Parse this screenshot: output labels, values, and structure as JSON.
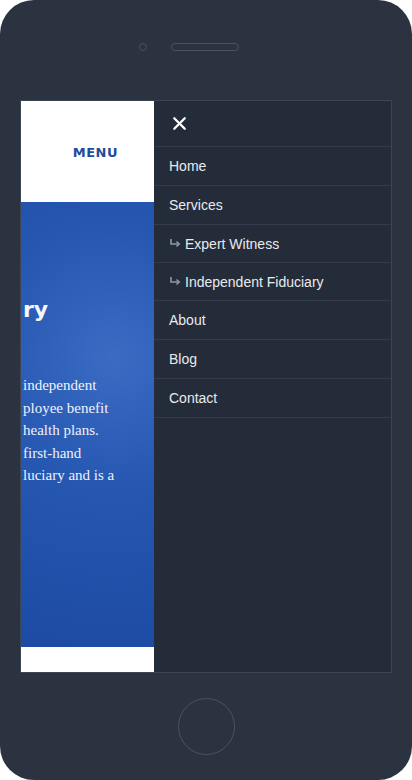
{
  "page": {
    "menu_button": "MENU",
    "hero": {
      "title": "ry",
      "lines": [
        "independent",
        "ployee benefit",
        "health plans.",
        "first-hand",
        "luciary and is a"
      ]
    }
  },
  "menu": {
    "items": [
      {
        "label": "Home",
        "kind": "main"
      },
      {
        "label": "Services",
        "kind": "main"
      },
      {
        "label": "Expert Witness",
        "kind": "sub"
      },
      {
        "label": "Independent Fiduciary",
        "kind": "sub"
      },
      {
        "label": "About",
        "kind": "main"
      },
      {
        "label": "Blog",
        "kind": "main"
      },
      {
        "label": "Contact",
        "kind": "main"
      }
    ]
  }
}
